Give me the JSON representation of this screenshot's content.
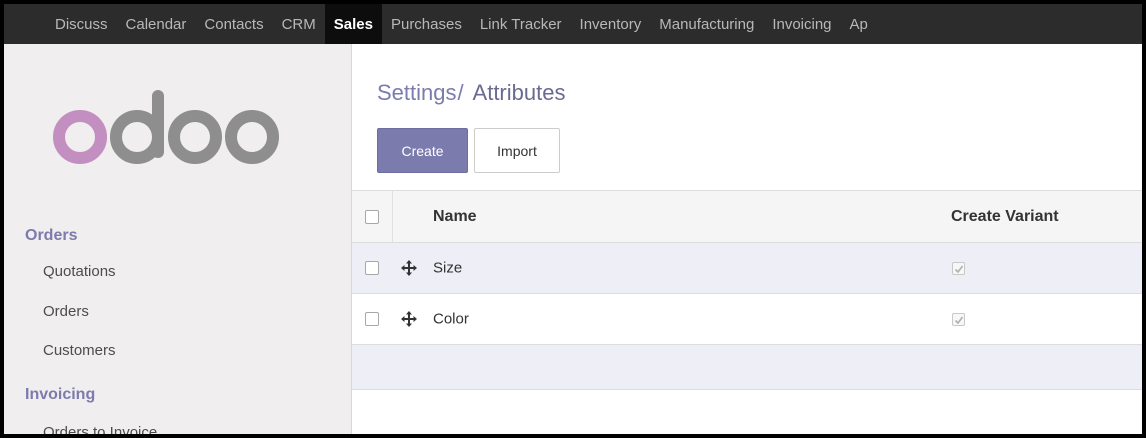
{
  "topbar": {
    "items": [
      "Discuss",
      "Calendar",
      "Contacts",
      "CRM",
      "Sales",
      "Purchases",
      "Link Tracker",
      "Inventory",
      "Manufacturing",
      "Invoicing",
      "Ap"
    ],
    "active": "Sales"
  },
  "sidebar": {
    "logo_text": "odoo",
    "sections": [
      {
        "title": "Orders",
        "links": [
          "Quotations",
          "Orders",
          "Customers"
        ]
      },
      {
        "title": "Invoicing",
        "links": [
          "Orders to Invoice"
        ]
      }
    ]
  },
  "main": {
    "breadcrumb": {
      "parent": "Settings",
      "separator": "/",
      "current": "Attributes"
    },
    "buttons": {
      "create": "Create",
      "import": "Import"
    },
    "table": {
      "columns": [
        "Name",
        "Create Variant"
      ],
      "rows": [
        {
          "name": "Size",
          "create_variant": true
        },
        {
          "name": "Color",
          "create_variant": true
        }
      ]
    }
  },
  "colors": {
    "accent": "#7c7bad",
    "logo_o": "#c28fc0",
    "logo_rest": "#8e8e8e",
    "topbar": "#2c2c2c"
  }
}
